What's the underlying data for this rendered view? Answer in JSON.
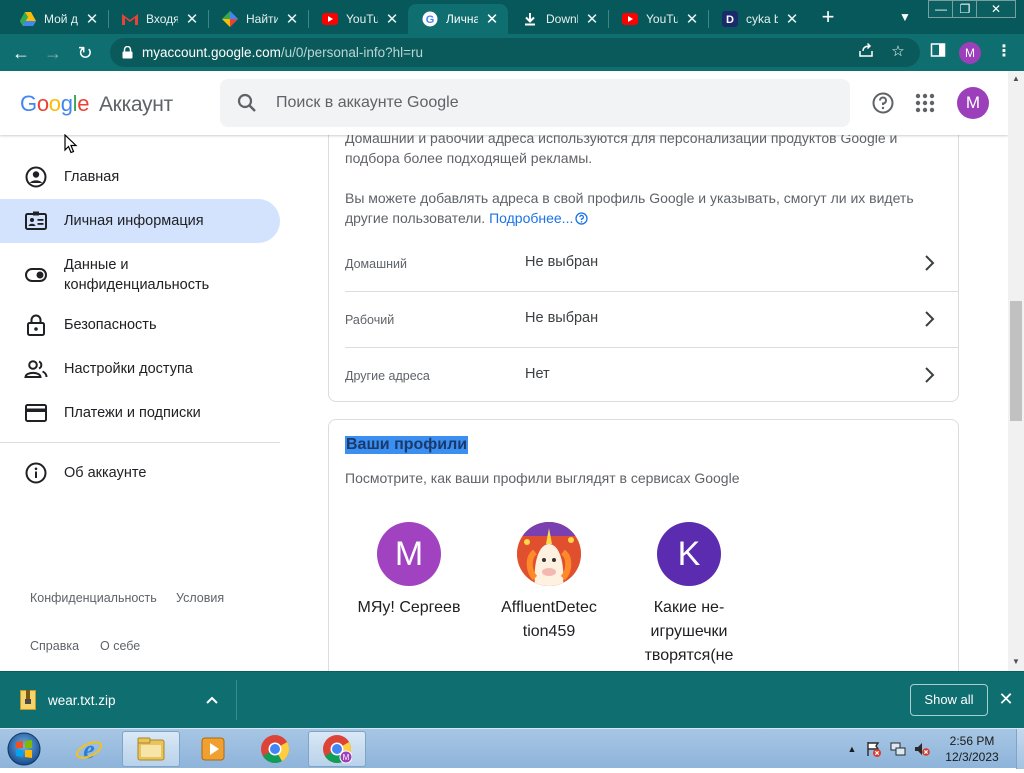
{
  "browser": {
    "tabs": [
      {
        "title": "Мой д",
        "icon": "google-drive-icon"
      },
      {
        "title": "Входя",
        "icon": "gmail-icon"
      },
      {
        "title": "Найти",
        "icon": "google-lens-icon"
      },
      {
        "title": "YouTul",
        "icon": "youtube-icon"
      },
      {
        "title": "Лична",
        "icon": "google-icon",
        "active": true
      },
      {
        "title": "Downl",
        "icon": "download-icon"
      },
      {
        "title": "YouTul",
        "icon": "youtube-icon"
      },
      {
        "title": "cyka b",
        "icon": "site-icon"
      }
    ],
    "new_tab": "+",
    "url_host": "myaccount.google.com",
    "url_path": "/u/0/personal-info?hl=ru",
    "profile_initial": "M"
  },
  "header": {
    "logo_google": [
      "G",
      "o",
      "o",
      "g",
      "l",
      "e"
    ],
    "logo_suffix": "Аккаунт",
    "search_placeholder": "Поиск в аккаунте Google",
    "avatar_initial": "M"
  },
  "sidebar": {
    "items": [
      {
        "label": "Главная",
        "icon": "account-circle-icon"
      },
      {
        "label": "Личная информация",
        "icon": "id-card-icon",
        "active": true
      },
      {
        "label": "Данные и\nконфиденциальность",
        "icon": "toggle-icon"
      },
      {
        "label": "Безопасность",
        "icon": "lock-icon"
      },
      {
        "label": "Настройки доступа",
        "icon": "people-icon"
      },
      {
        "label": "Платежи и подписки",
        "icon": "credit-card-icon"
      },
      {
        "label": "Об аккаунте",
        "icon": "info-icon"
      }
    ],
    "footer": {
      "privacy": "Конфиденциальность",
      "terms": "Условия",
      "help": "Справка",
      "about": "О себе"
    }
  },
  "addresses": {
    "intro": "Домашний и рабочий адреса используются для персонализации продуктов Google и подбора более подходящей рекламы.",
    "info": "Вы можете добавлять адреса в свой профиль Google и указывать, смогут ли их видеть другие пользователи.",
    "more_link": "Подробнее...",
    "rows": [
      {
        "label": "Домашний",
        "value": "Не выбран"
      },
      {
        "label": "Рабочий",
        "value": "Не выбран"
      },
      {
        "label": "Другие адреса",
        "value": "Нет"
      }
    ]
  },
  "profiles": {
    "title": "Ваши профили",
    "subtitle": "Посмотрите, как ваши профили выглядят в сервисах Google",
    "items": [
      {
        "initial": "M",
        "name": "MЯу! Сергеев",
        "color": "#a142c1"
      },
      {
        "initial": "",
        "name": "AffluentDetec\ntion459",
        "color": "#f08a2c"
      },
      {
        "initial": "K",
        "name": "Какие не-\nигрушечки\nтворятся(не",
        "color": "#5b2bb0"
      }
    ]
  },
  "download": {
    "file": "wear.txt.zip",
    "show_all": "Show all"
  },
  "taskbar": {
    "time": "2:56 PM",
    "date": "12/3/2023"
  },
  "colors": {
    "chrome_frame": "#07585a",
    "chrome_toolbar": "#0f6e70",
    "active_nav": "#d3e3fd",
    "link": "#1a73e8"
  }
}
